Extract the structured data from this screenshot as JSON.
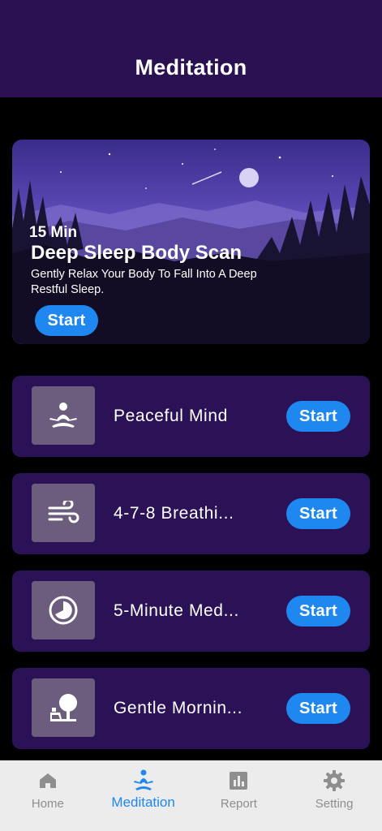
{
  "header": {
    "title": "Meditation"
  },
  "hero": {
    "duration": "15 Min",
    "title": "Deep Sleep Body Scan",
    "description": "Gently Relax Your Body To Fall Into A Deep Restful Sleep.",
    "start_label": "Start"
  },
  "sessions": [
    {
      "label": "Peaceful Mind",
      "icon": "meditation-pose-icon",
      "start_label": "Start"
    },
    {
      "label": "4-7-8 Breathi...",
      "icon": "wind-icon",
      "start_label": "Start"
    },
    {
      "label": "5-Minute Med...",
      "icon": "timer-pie-icon",
      "start_label": "Start"
    },
    {
      "label": "Gentle Mornin...",
      "icon": "morning-sun-icon",
      "start_label": "Start"
    }
  ],
  "tabs": [
    {
      "label": "Home",
      "icon": "home-icon"
    },
    {
      "label": "Meditation",
      "icon": "meditation-icon",
      "active": true
    },
    {
      "label": "Report",
      "icon": "bar-chart-icon"
    },
    {
      "label": "Setting",
      "icon": "gear-icon"
    }
  ],
  "colors": {
    "header_bg": "#2a1252",
    "card_bg": "#2b1256",
    "accent": "#1e88f0",
    "icon_box": "#6c5c7e",
    "tab_inactive": "#8e8e8e"
  }
}
